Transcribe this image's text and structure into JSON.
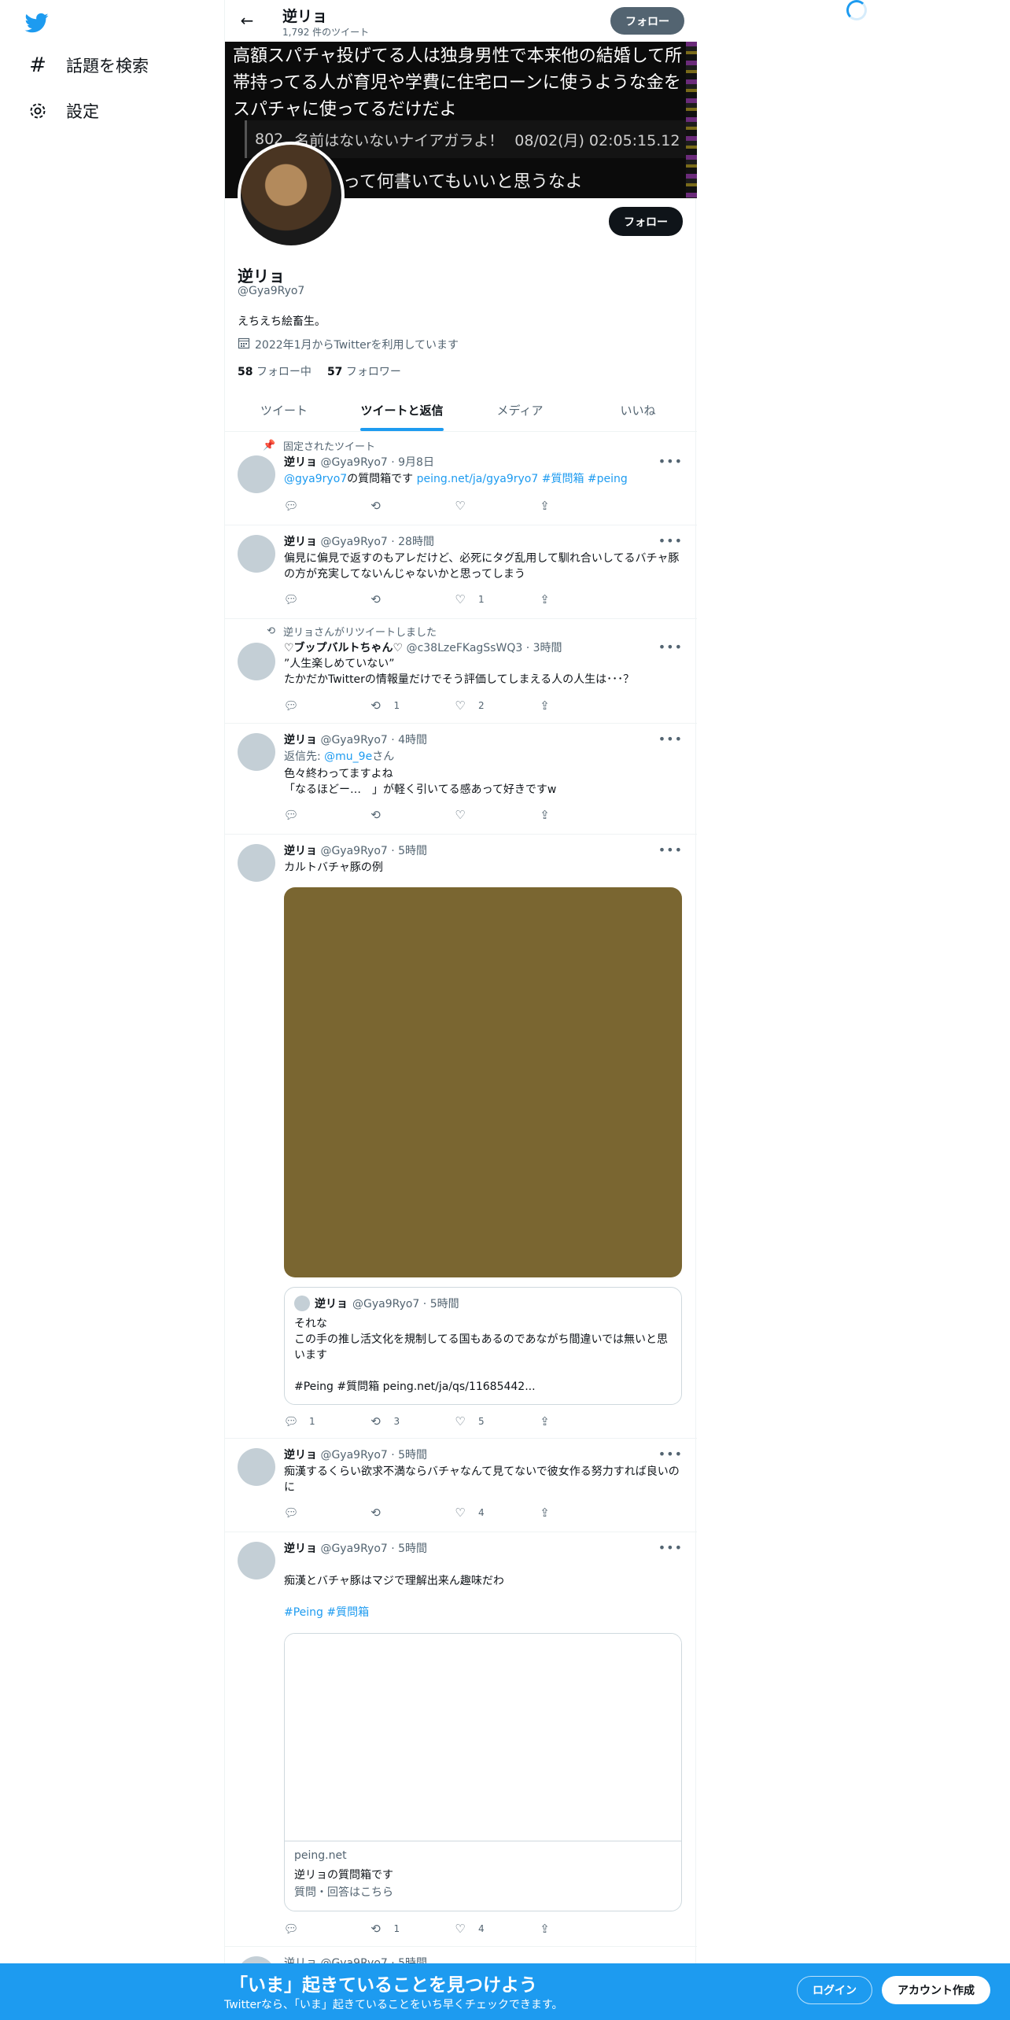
{
  "colors": {
    "accent": "#1d9bf0",
    "text": "#0f1419",
    "secondary": "#536471",
    "media_placeholder": "#7a6631"
  },
  "sidebar": {
    "logo": "twitter-bird-icon",
    "items": [
      {
        "icon": "hashtag-icon",
        "label": "話題を検索"
      },
      {
        "icon": "gear-icon",
        "label": "設定"
      }
    ]
  },
  "header": {
    "name": "逆リョ",
    "tweet_count": "1,792 件のツイート",
    "follow_label": "フォロー"
  },
  "banner": {
    "line1": "高額スパチャ投げてる人は独身男性で本来他の結婚して所帯持ってる人が育児や学費に住宅ローンに使うような金をスパチャに使ってるだけだよ",
    "post_no": "802",
    "post_name": "名前はないないナイアガラよ！",
    "post_date": "08/02(月) 02:05:15.12",
    "line2": "って何書いてもいいと思うなよ"
  },
  "profile": {
    "follow_label": "フォロー",
    "name": "逆リョ",
    "handle": "@Gya9Ryo7",
    "bio": "えちえち絵畜生。",
    "joined": "2022年1月からTwitterを利用しています",
    "following_count": "58",
    "following_label": "フォロー中",
    "followers_count": "57",
    "followers_label": "フォロワー"
  },
  "tabs": [
    "ツイート",
    "ツイートと返信",
    "メディア",
    "いいね"
  ],
  "tweets": [
    {
      "social": "固定されたツイート",
      "name": "逆リョ",
      "meta": "@Gya9Ryo7 · 9月8日",
      "mention": "@gya9ryo7",
      "text_mid": "の質問箱です ",
      "links": "peing.net/ja/gya9ryo7 #質問箱 #peing",
      "reply": "",
      "rt": "",
      "like": ""
    },
    {
      "name": "逆リョ",
      "meta": "@Gya9Ryo7 · 28時間",
      "text": "偏見に偏見で返すのもアレだけど、必死にタグ乱用して馴れ合いしてるバチャ豚の方が充実してないんじゃないかと思ってしまう",
      "reply": "",
      "rt": "",
      "like": "1"
    },
    {
      "social": "逆リョさんがリツイートしました",
      "name": "♡ブップバルトちゃん♡",
      "meta": "@c38LzeFKagSsWQ3 · 3時間",
      "text": "”人生楽しめていない”\nたかだかTwitterの情報量だけでそう評価してしまえる人の人生は･･･？",
      "reply": "",
      "rt": "1",
      "like": "2"
    },
    {
      "name": "逆リョ",
      "meta": "@Gya9Ryo7 · 4時間",
      "reply_to_prefix": "返信先: ",
      "reply_to": "@mu_9e",
      "reply_to_suffix": "さん",
      "text": "色々終わってますよね\n「なるほどー…　」が軽く引いてる感あって好きですw",
      "reply": "",
      "rt": "",
      "like": ""
    },
    {
      "name": "逆リョ",
      "meta": "@Gya9Ryo7 · 5時間",
      "text": "カルトバチャ豚の例",
      "quote": {
        "name": "逆リョ",
        "meta": "@Gya9Ryo7 · 5時間",
        "text": "それな\nこの手の推し活文化を規制してる国もあるのであながち間違いでは無いと思います\n\n#Peing #質問箱 peing.net/ja/qs/11685442..."
      },
      "reply": "1",
      "rt": "3",
      "like": "5"
    },
    {
      "name": "逆リョ",
      "meta": "@Gya9Ryo7 · 5時間",
      "text": "痴漢するくらい欲求不満ならバチャなんて見てないで彼女作る努力すれば良いのに",
      "reply": "",
      "rt": "",
      "like": "4"
    },
    {
      "name": "逆リョ",
      "meta": "@Gya9Ryo7 · 5時間",
      "text": "痴漢とバチャ豚はマジで理解出来ん趣味だわ",
      "tags": "#Peing #質問箱",
      "card": {
        "domain": "peing.net",
        "title": "逆リョの質問箱です",
        "desc": "質問・回答はこちら"
      },
      "reply": "",
      "rt": "1",
      "like": "4"
    }
  ],
  "partial_next": "逆リョ @Gya9Ryo7 · 5時間",
  "bottom_bar": {
    "title": "「いま」起きていることを見つけよう",
    "subtitle": "Twitterなら、「いま」起きていることをいち早くチェックできます。",
    "login": "ログイン",
    "signup": "アカウント作成"
  }
}
